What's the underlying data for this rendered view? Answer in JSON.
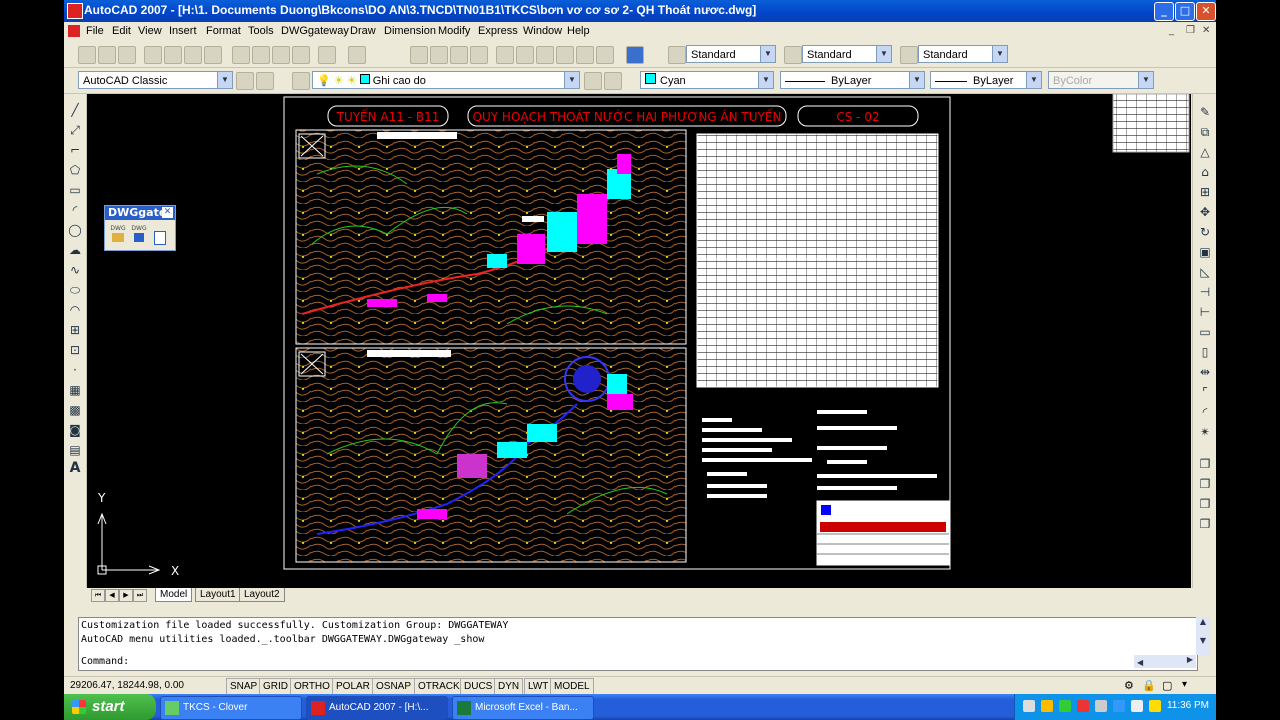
{
  "window": {
    "title": "AutoCAD 2007 - [H:\\1. Documents Duong\\Bkcons\\DO AN\\3.TNCD\\TN01B1\\TKCS\\bơn vơ cơ sơ 2- QH Thoát nươc.dwg]",
    "min": "_",
    "max": "□",
    "close": "✕"
  },
  "menu": [
    "File",
    "Edit",
    "View",
    "Insert",
    "Format",
    "Tools",
    "DWGgateway",
    "Draw",
    "Dimension",
    "Modify",
    "Express",
    "Window",
    "Help"
  ],
  "toolbar": {
    "text_style": "Standard",
    "dim_style": "Standard",
    "table_style": "Standard",
    "workspace": "AutoCAD Classic",
    "layer": "Ghi cao do",
    "color": "Cyan",
    "linetype": "ByLayer",
    "lineweight": "ByLayer",
    "plotstyle": "ByColor"
  },
  "dwggate": {
    "title": "DWGgate",
    "btn1": "DWG",
    "btn2": "DWG"
  },
  "drawing": {
    "frame_titles": [
      "TUYẾN A11 - B11",
      "QUY HOẠCH THOÁT NƯỚC HAI PHƯƠNG ÁN TUYẾN",
      "CS - 02"
    ],
    "ucs_y": "Y",
    "ucs_x": "X"
  },
  "tabs": [
    "Model",
    "Layout1",
    "Layout2"
  ],
  "command": {
    "line1": "Customization file loaded successfully. Customization Group: DWGGATEWAY",
    "line2": "AutoCAD menu utilities loaded._.toolbar DWGGATEWAY.DWGgateway _show",
    "prompt": "Command:"
  },
  "status": {
    "coords": "29206.47, 18244.98, 0.00",
    "buttons": [
      "SNAP",
      "GRID",
      "ORTHO",
      "POLAR",
      "OSNAP",
      "OTRACK",
      "DUCS",
      "DYN",
      "LWT",
      "MODEL"
    ]
  },
  "taskbar": {
    "start": "start",
    "tasks": [
      "TKCS - Clover",
      "AutoCAD 2007 - [H:\\...",
      "Microsoft Excel - Ban..."
    ],
    "clock": "11:36 PM"
  }
}
